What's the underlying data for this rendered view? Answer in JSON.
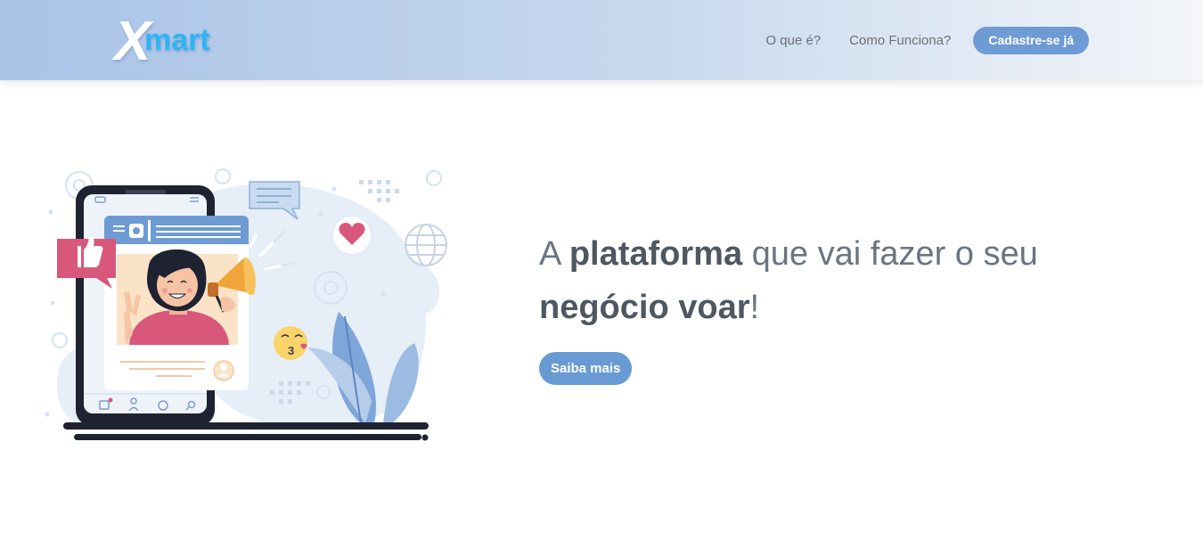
{
  "brand": {
    "logo_x": "X",
    "logo_rest": "mart"
  },
  "nav": {
    "items": [
      {
        "label": "O que é?"
      },
      {
        "label": "Como Funciona?"
      }
    ],
    "cta_label": "Cadastre-se já"
  },
  "hero": {
    "headline": {
      "part1": "A ",
      "bold1": "plataforma",
      "part2": " que vai fazer o seu ",
      "bold2": "negócio voar",
      "part3": "!"
    },
    "cta_label": "Saiba mais",
    "illustration_icons": [
      "thumbs-up-icon",
      "heart-icon",
      "megaphone-icon",
      "globe-icon",
      "gear-icon",
      "chat-bubble-icon",
      "kiss-emoji-icon",
      "user-icon",
      "search-icon",
      "plant-icon"
    ]
  },
  "colors": {
    "accent": "#6e9bd4",
    "logo_blue": "#2db4f3",
    "text": "#6c7480",
    "text_bold": "#4f5761"
  }
}
